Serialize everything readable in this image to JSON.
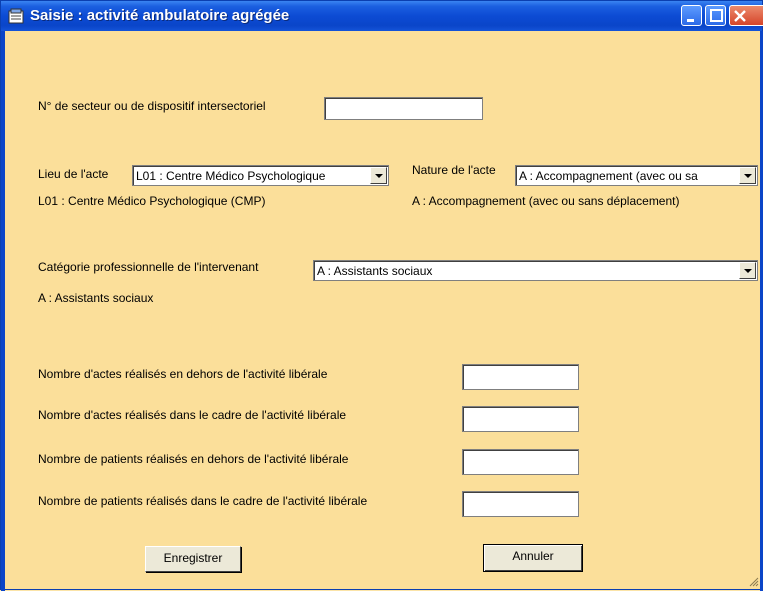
{
  "window": {
    "title": "Saisie : activité ambulatoire agrégée"
  },
  "secteur": {
    "label": "N° de secteur ou de dispositif intersectoriel",
    "value": ""
  },
  "lieu": {
    "label": "Lieu de l'acte",
    "selected": "L01 : Centre Médico Psychologique",
    "caption": "L01 : Centre Médico Psychologique (CMP)"
  },
  "nature": {
    "label": "Nature de l'acte",
    "selected": "A : Accompagnement (avec ou sa",
    "caption": "A : Accompagnement (avec ou sans déplacement)"
  },
  "categorie": {
    "label": "Catégorie professionnelle de l'intervenant",
    "selected": "A : Assistants sociaux",
    "caption": "A : Assistants sociaux"
  },
  "counts": [
    {
      "label": "Nombre d'actes réalisés en dehors de l'activité libérale",
      "value": ""
    },
    {
      "label": "Nombre d'actes réalisés dans le cadre de l'activité libérale",
      "value": ""
    },
    {
      "label": "Nombre de patients réalisés en dehors de l'activité libérale",
      "value": ""
    },
    {
      "label": "Nombre de patients réalisés dans le cadre de l'activité libérale",
      "value": ""
    }
  ],
  "buttons": {
    "save": "Enregistrer",
    "cancel": "Annuler"
  }
}
